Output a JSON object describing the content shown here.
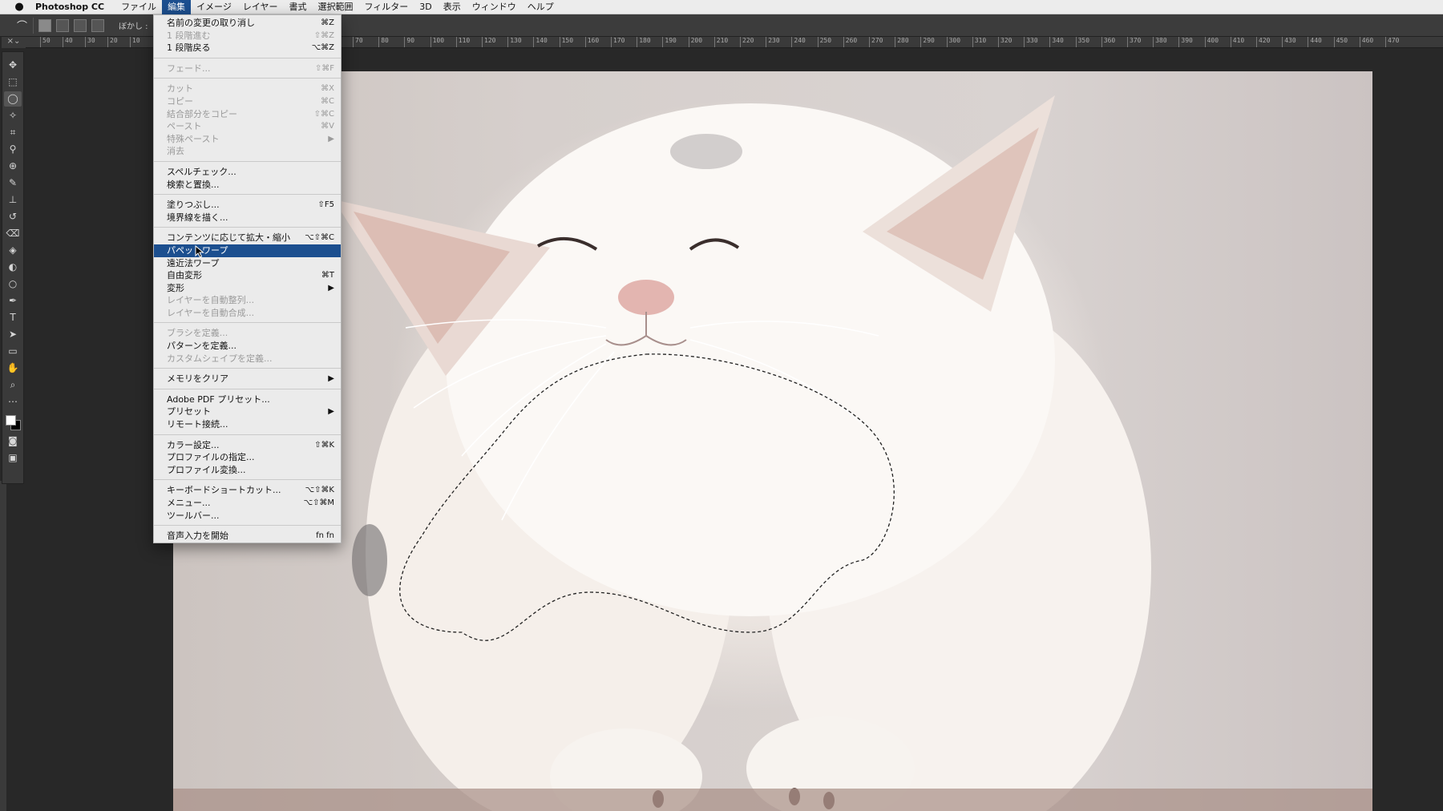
{
  "menubar": {
    "app_name": "Photoshop CC",
    "items": [
      "ファイル",
      "編集",
      "イメージ",
      "レイヤー",
      "書式",
      "選択範囲",
      "フィルター",
      "3D",
      "表示",
      "ウィンドウ",
      "ヘルプ"
    ],
    "active_index": 1
  },
  "options_bar": {
    "feather_label": "ぼかし :"
  },
  "ruler": {
    "left_labels": [
      "50",
      "40",
      "30",
      "20",
      "10"
    ],
    "labels": [
      "70",
      "80",
      "90",
      "100",
      "110",
      "120",
      "130",
      "140",
      "150",
      "160",
      "170",
      "180",
      "190",
      "200",
      "210",
      "220",
      "230",
      "240",
      "250",
      "260",
      "270",
      "280",
      "290",
      "300",
      "310",
      "320",
      "330",
      "340",
      "350",
      "360",
      "370",
      "380",
      "390",
      "400",
      "410",
      "420",
      "430",
      "440",
      "450",
      "460",
      "470"
    ]
  },
  "toolbar": {
    "tools": [
      "move-icon",
      "marquee-icon",
      "lasso-icon",
      "magic-wand-icon",
      "crop-icon",
      "eyedropper-icon",
      "healing-icon",
      "brush-icon",
      "stamp-icon",
      "history-brush-icon",
      "eraser-icon",
      "bucket-icon",
      "blur-icon",
      "dodge-icon",
      "pen-icon",
      "type-icon",
      "path-select-icon",
      "rectangle-icon",
      "hand-icon",
      "zoom-icon",
      "more-icon"
    ],
    "selected_tool": "lasso-icon"
  },
  "edit_menu": {
    "sections": [
      [
        {
          "label": "名前の変更の取り消し",
          "shortcut": "⌘Z",
          "enabled": true
        },
        {
          "label": "1 段階進む",
          "shortcut": "⇧⌘Z",
          "enabled": false
        },
        {
          "label": "1 段階戻る",
          "shortcut": "⌥⌘Z",
          "enabled": true
        }
      ],
      [
        {
          "label": "フェード...",
          "shortcut": "⇧⌘F",
          "enabled": false
        }
      ],
      [
        {
          "label": "カット",
          "shortcut": "⌘X",
          "enabled": false
        },
        {
          "label": "コピー",
          "shortcut": "⌘C",
          "enabled": false
        },
        {
          "label": "結合部分をコピー",
          "shortcut": "⇧⌘C",
          "enabled": false
        },
        {
          "label": "ペースト",
          "shortcut": "⌘V",
          "enabled": false
        },
        {
          "label": "特殊ペースト",
          "shortcut": "",
          "enabled": false,
          "submenu": true
        },
        {
          "label": "消去",
          "shortcut": "",
          "enabled": false
        }
      ],
      [
        {
          "label": "スペルチェック...",
          "shortcut": "",
          "enabled": true
        },
        {
          "label": "検索と置換...",
          "shortcut": "",
          "enabled": true
        }
      ],
      [
        {
          "label": "塗りつぶし...",
          "shortcut": "⇧F5",
          "enabled": true
        },
        {
          "label": "境界線を描く...",
          "shortcut": "",
          "enabled": true
        }
      ],
      [
        {
          "label": "コンテンツに応じて拡大・縮小",
          "shortcut": "⌥⇧⌘C",
          "enabled": true
        },
        {
          "label": "パペットワープ",
          "shortcut": "",
          "enabled": true,
          "highlighted": true
        },
        {
          "label": "遠近法ワープ",
          "shortcut": "",
          "enabled": true
        },
        {
          "label": "自由変形",
          "shortcut": "⌘T",
          "enabled": true
        },
        {
          "label": "変形",
          "shortcut": "",
          "enabled": true,
          "submenu": true
        },
        {
          "label": "レイヤーを自動整列...",
          "shortcut": "",
          "enabled": false
        },
        {
          "label": "レイヤーを自動合成...",
          "shortcut": "",
          "enabled": false
        }
      ],
      [
        {
          "label": "ブラシを定義...",
          "shortcut": "",
          "enabled": false
        },
        {
          "label": "パターンを定義...",
          "shortcut": "",
          "enabled": true
        },
        {
          "label": "カスタムシェイプを定義...",
          "shortcut": "",
          "enabled": false
        }
      ],
      [
        {
          "label": "メモリをクリア",
          "shortcut": "",
          "enabled": true,
          "submenu": true
        }
      ],
      [
        {
          "label": "Adobe PDF プリセット...",
          "shortcut": "",
          "enabled": true
        },
        {
          "label": "プリセット",
          "shortcut": "",
          "enabled": true,
          "submenu": true
        },
        {
          "label": "リモート接続...",
          "shortcut": "",
          "enabled": true
        }
      ],
      [
        {
          "label": "カラー設定...",
          "shortcut": "⇧⌘K",
          "enabled": true
        },
        {
          "label": "プロファイルの指定...",
          "shortcut": "",
          "enabled": true
        },
        {
          "label": "プロファイル変換...",
          "shortcut": "",
          "enabled": true
        }
      ],
      [
        {
          "label": "キーボードショートカット...",
          "shortcut": "⌥⇧⌘K",
          "enabled": true
        },
        {
          "label": "メニュー...",
          "shortcut": "⌥⇧⌘M",
          "enabled": true
        },
        {
          "label": "ツールバー...",
          "shortcut": "",
          "enabled": true
        }
      ],
      [
        {
          "label": "音声入力を開始",
          "shortcut": "fn fn",
          "enabled": true
        }
      ]
    ]
  },
  "colors": {
    "menu_highlight": "#1c4f8f",
    "foreground": "#ffffff",
    "background": "#000000"
  }
}
